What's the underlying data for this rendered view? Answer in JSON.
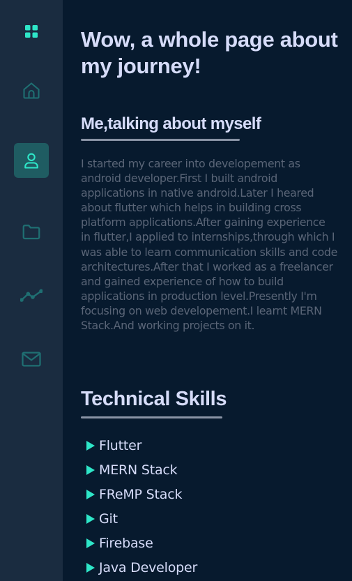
{
  "sidebar": {
    "accent_color": "#2ee6c8",
    "items": [
      {
        "icon": "grid-icon",
        "active": false
      },
      {
        "icon": "home-icon",
        "active": false
      },
      {
        "icon": "user-icon",
        "active": true
      },
      {
        "icon": "folder-icon",
        "active": false
      },
      {
        "icon": "trending-icon",
        "active": false
      },
      {
        "icon": "mail-icon",
        "active": false
      }
    ]
  },
  "main": {
    "title": "Wow, a whole page about my journey!",
    "about": {
      "heading": "Me,talking about myself",
      "text": "I started my career into developement as android developer.First I built android applications in native android.Later I heared about flutter which helps in building cross platform applications.After gaining experience in flutter,I applied to internships,through which I was able to learn communication skills and code architectures.After that I worked as a freelancer and gained experience of how to build applications in production level.Presently I'm focusing on web developement.I learnt MERN Stack.And working projects on it."
    },
    "skills": {
      "heading": "Technical Skills",
      "items": [
        "Flutter",
        "MERN Stack",
        "FReMP Stack",
        "Git",
        "Firebase",
        "Java Developer"
      ]
    }
  }
}
